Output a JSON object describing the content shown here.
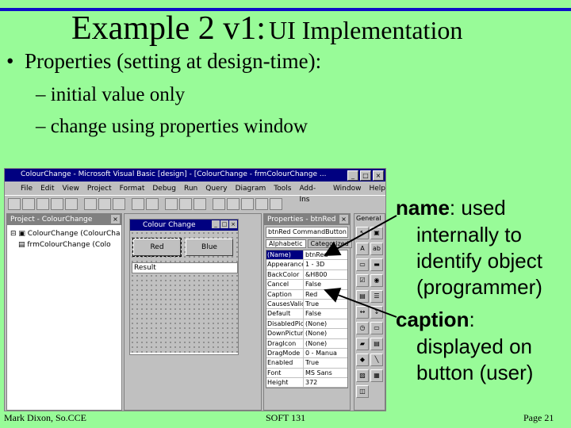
{
  "slide": {
    "title_main": "Example 2 v1:",
    "title_rest": "UI Implementation",
    "bullet": "Properties (setting at design-time):",
    "sub1": "initial value only",
    "sub2": "change using properties window",
    "accent_color": "#1010c8",
    "background_color": "#98fb98"
  },
  "annotations": {
    "name_term": "name",
    "name_line1": ": used",
    "name_line2": "internally to",
    "name_line3": "identify object",
    "name_line4": "(programmer)",
    "caption_term": "caption",
    "caption_line1": ":",
    "caption_line2": "displayed on",
    "caption_line3": "button (user)"
  },
  "footer": {
    "author": "Mark Dixon, So.CCE",
    "course": "SOFT 131",
    "page": "Page 21"
  },
  "ide": {
    "window_title": "ColourChange - Microsoft Visual Basic [design] - [ColourChange - frmColourChange ...",
    "menu": [
      "File",
      "Edit",
      "View",
      "Project",
      "Format",
      "Debug",
      "Run",
      "Query",
      "Diagram",
      "Tools",
      "Add-Ins",
      "Window",
      "Help"
    ],
    "project_title": "Project - ColourChange",
    "project_tree": [
      "ColourChange (ColourCha",
      "frmColourChange (Colo"
    ],
    "form_title": "Colour Change",
    "btn_red": "Red",
    "btn_blue": "Blue",
    "result_label": "Result",
    "props_title": "Properties - btnRed",
    "props_combo": "btnRed CommandButton",
    "props_tab_alpha": "Alphabetic",
    "props_tab_cat": "Categorized",
    "props_rows": [
      {
        "k": "(Name)",
        "v": "btnRed"
      },
      {
        "k": "Appearance",
        "v": "1 - 3D"
      },
      {
        "k": "BackColor",
        "v": "&H800"
      },
      {
        "k": "Cancel",
        "v": "False"
      },
      {
        "k": "Caption",
        "v": "Red"
      },
      {
        "k": "CausesValid",
        "v": "True"
      },
      {
        "k": "Default",
        "v": "False"
      },
      {
        "k": "DisabledPict",
        "v": "(None)"
      },
      {
        "k": "DownPicture",
        "v": "(None)"
      },
      {
        "k": "DragIcon",
        "v": "(None)"
      },
      {
        "k": "DragMode",
        "v": "0 - Manua"
      },
      {
        "k": "Enabled",
        "v": "True"
      },
      {
        "k": "Font",
        "v": "MS Sans"
      },
      {
        "k": "Height",
        "v": "372"
      }
    ],
    "toolbox_title": "General"
  }
}
